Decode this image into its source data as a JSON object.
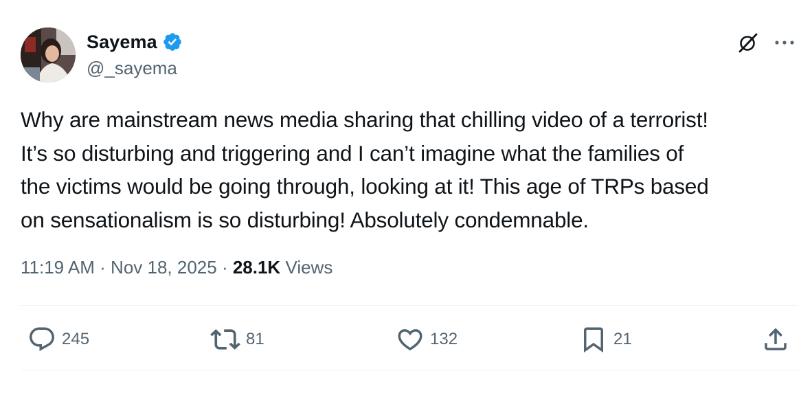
{
  "author": {
    "display_name": "Sayema",
    "handle": "@_sayema",
    "verified": true,
    "verified_color": "#1d9bf0"
  },
  "tweet": {
    "text_lines": [
      "Why are mainstream news media sharing that chilling video of a terrorist!",
      "It’s so disturbing and triggering and I can’t imagine what the families of",
      "the victims would be going through, looking at it! This age of TRPs based",
      "on sensationalism is so disturbing! Absolutely condemnable."
    ]
  },
  "meta": {
    "time": "11:19 AM",
    "separator": " · ",
    "date": "Nov 18, 2025",
    "views_count": "28.1K",
    "views_label": " Views"
  },
  "actions": {
    "replies": "245",
    "reposts": "81",
    "likes": "132",
    "bookmarks": "21"
  },
  "icons": {
    "reply": "reply-bubble-icon",
    "repost": "repost-icon",
    "like": "heart-icon",
    "bookmark": "bookmark-icon",
    "share": "share-icon",
    "grok": "grok-icon",
    "more": "more-dots-icon"
  },
  "colors": {
    "text": "#0f1419",
    "secondary": "#536471",
    "divider": "#eff3f4",
    "accent": "#1d9bf0"
  }
}
